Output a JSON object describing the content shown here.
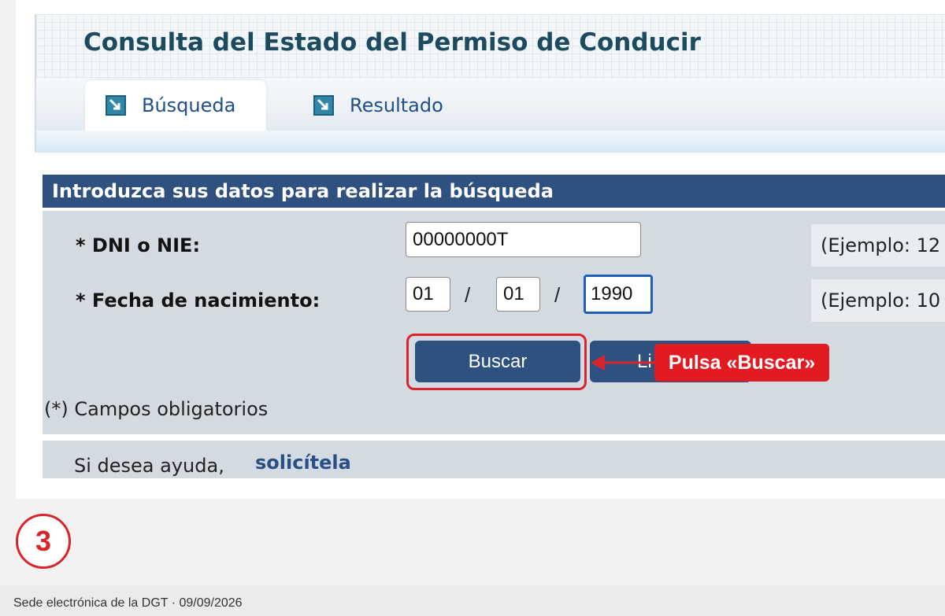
{
  "header": {
    "title": "Consulta del Estado del Permiso de Conducir",
    "tabs": [
      {
        "label": "Búsqueda",
        "active": true
      },
      {
        "label": "Resultado",
        "active": false
      }
    ]
  },
  "form": {
    "section_title": "Introduzca sus datos para realizar la búsqueda",
    "dni": {
      "label": "* DNI o NIE:",
      "value": "00000000T",
      "example": "(Ejemplo: 12"
    },
    "birth_date": {
      "label": "* Fecha de nacimiento:",
      "day": "01",
      "month": "01",
      "year": "1990",
      "separator": "/",
      "example": "(Ejemplo: 10"
    },
    "search_button": "Buscar",
    "clear_button": "Li",
    "required_note": "(*) Campos obligatorios"
  },
  "help": {
    "text": "Si desea ayuda,",
    "link": "solicítela"
  },
  "annotation": {
    "callout": "Pulsa «Buscar»",
    "step": "3",
    "color": "#d9242b"
  },
  "footer": {
    "text": "Sede electrónica de la DGT · 09/09/2026"
  },
  "colors": {
    "accent": "#2e5180",
    "title": "#1c4b60",
    "tab_text": "#1f4f87",
    "panel": "#d3dae2"
  }
}
